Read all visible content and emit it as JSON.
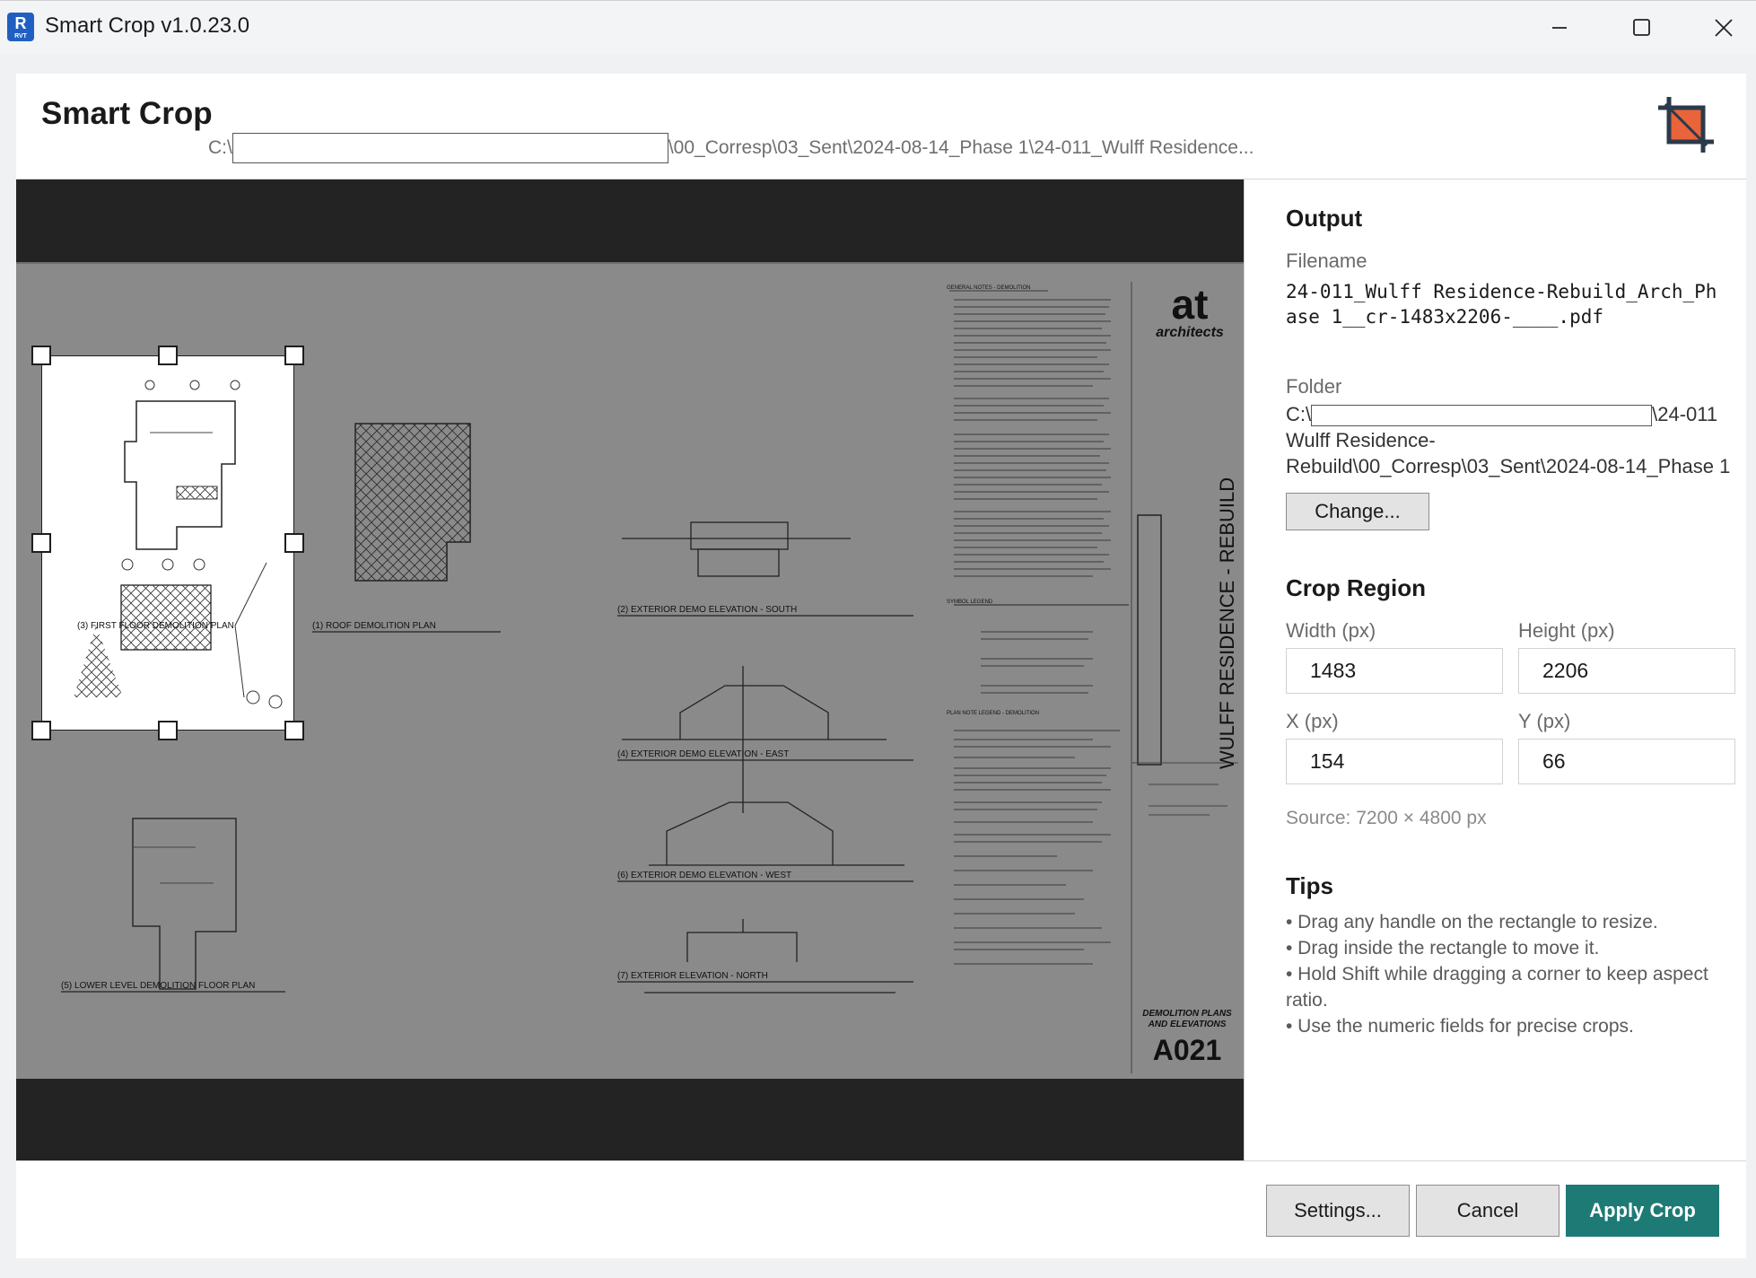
{
  "window": {
    "title": "Smart Crop v1.0.23.0",
    "app_icon_letter": "R",
    "app_icon_sub": "RVT",
    "controls": [
      "minimize-icon",
      "maximize-icon",
      "close-icon"
    ]
  },
  "header": {
    "title": "Smart Crop",
    "path_prefix": "C:\\",
    "path_suffix": "\\00_Corresp\\03_Sent\\2024-08-14_Phase 1\\24-011_Wulff Residence..."
  },
  "preview": {
    "icon": "crop-icon",
    "sheet_number": "A021",
    "sheet_title_line1": "DEMOLITION PLANS",
    "sheet_title_line2": "AND ELEVATIONS",
    "project_vertical": "WULFF RESIDENCE - REBUILD",
    "firm_logo_line1": "at",
    "firm_logo_line2": "architects",
    "view_labels": [
      {
        "num": "3",
        "text": "FIRST FLOOR DEMOLITION PLAN"
      },
      {
        "num": "1",
        "text": "ROOF DEMOLITION PLAN"
      },
      {
        "num": "2",
        "text": "EXTERIOR DEMO ELEVATION - SOUTH"
      },
      {
        "num": "4",
        "text": "EXTERIOR DEMO ELEVATION - EAST"
      },
      {
        "num": "6",
        "text": "EXTERIOR DEMO ELEVATION - WEST"
      },
      {
        "num": "7",
        "text": "EXTERIOR ELEVATION - NORTH"
      },
      {
        "num": "5",
        "text": "LOWER LEVEL DEMOLITION FLOOR PLAN"
      }
    ],
    "notes_headers": [
      "GENERAL NOTES - DEMOLITION",
      "SYMBOL LEGEND",
      "PLAN NOTE LEGEND - DEMOLITION"
    ],
    "accent_color": "#e9643a"
  },
  "output": {
    "section_title": "Output",
    "filename_label": "Filename",
    "filename": "24-011_Wulff Residence-Rebuild_Arch_Phase 1__cr-1483x2206-____.pdf",
    "folder_label": "Folder",
    "folder_prefix": "C:\\",
    "folder_suffix": "\\24-011",
    "folder_rest": "Wulff Residence-Rebuild\\00_Corresp\\03_Sent\\2024-08-14_Phase 1",
    "change_button": "Change..."
  },
  "crop_region": {
    "section_title": "Crop Region",
    "width_label": "Width (px)",
    "width_value": "1483",
    "height_label": "Height (px)",
    "height_value": "2206",
    "x_label": "X (px)",
    "x_value": "154",
    "y_label": "Y (px)",
    "y_value": "66",
    "source_text": "Source: 7200 × 4800 px"
  },
  "tips": {
    "section_title": "Tips",
    "items": [
      "• Drag any handle on the rectangle to resize.",
      "• Drag inside the rectangle to move it.",
      "• Hold Shift while dragging a corner to keep aspect ratio.",
      "• Use the numeric fields for precise crops."
    ]
  },
  "footer": {
    "settings_button": "Settings...",
    "cancel_button": "Cancel",
    "apply_button": "Apply Crop",
    "apply_color": "#1e7a75"
  }
}
